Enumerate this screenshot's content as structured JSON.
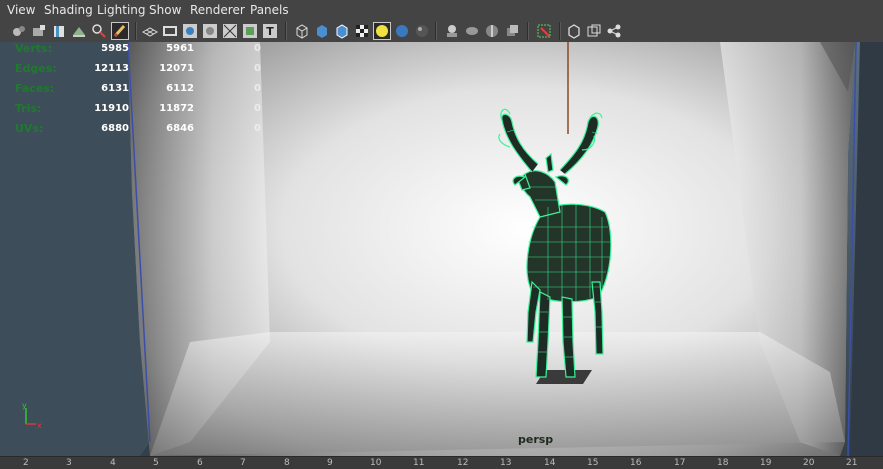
{
  "menu": [
    "View",
    "Shading",
    "Lighting",
    "Show",
    "Renderer",
    "Panels"
  ],
  "toolbar_icons": [
    "camera-select-icon",
    "camera-attributes-icon",
    "bookmarks-icon",
    "image-plane-icon",
    "two-d-pan-zoom-icon",
    "grease-pencil-icon",
    "grid-icon",
    "film-gate-icon",
    "resolution-gate-icon",
    "gate-mask-icon",
    "field-chart-icon",
    "safe-action-icon",
    "safe-title-icon",
    "wireframe-icon",
    "smooth-shade-icon",
    "wireframe-on-shaded-icon",
    "textured-icon",
    "use-lights-icon",
    "shadows-icon",
    "screen-space-ao-icon",
    "motion-blur-icon",
    "multisample-aa-icon",
    "depth-of-field-icon",
    "isolate-select-icon",
    "xray-icon",
    "xray-joints-icon",
    "xray-active-components-icon"
  ],
  "hud": {
    "rows": [
      {
        "label": "Verts:",
        "v1": "5985",
        "v2": "5961",
        "v3": "0"
      },
      {
        "label": "Edges:",
        "v1": "12113",
        "v2": "12071",
        "v3": "0"
      },
      {
        "label": "Faces:",
        "v1": "6131",
        "v2": "6112",
        "v3": "0"
      },
      {
        "label": "Tris:",
        "v1": "11910",
        "v2": "11872",
        "v3": "0"
      },
      {
        "label": "UVs:",
        "v1": "6880",
        "v2": "6846",
        "v3": "0"
      }
    ]
  },
  "camera_label": "persp",
  "axis": {
    "x": "x",
    "y": "y"
  },
  "ruler_ticks": [
    "2",
    "3",
    "4",
    "5",
    "6",
    "7",
    "8",
    "9",
    "10",
    "11",
    "12",
    "13",
    "14",
    "15",
    "16",
    "17",
    "18",
    "19",
    "20",
    "21"
  ],
  "colors": {
    "wire": "#3cf29a",
    "hud_label": "#1f7a2e",
    "menubar": "#444444"
  }
}
